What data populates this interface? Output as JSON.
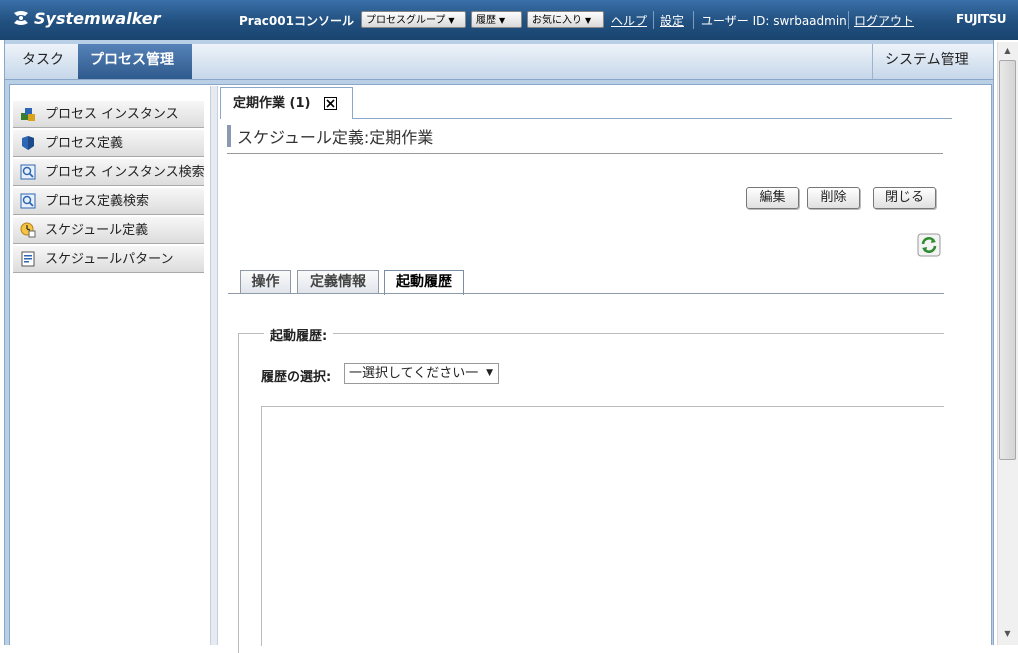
{
  "header": {
    "product": "Systemwalker",
    "console_title": "Prac001コンソール",
    "process_group_btn": "プロセスグループ",
    "history_btn": "履歴",
    "favorites_btn": "お気に入り",
    "help_link": "ヘルプ",
    "settings_link": "設定",
    "user_id": "ユーザー ID: swrbaadmin",
    "logout_link": "ログアウト",
    "vendor_logo": "FUJITSU"
  },
  "nav": {
    "task": "タスク",
    "process_mgmt": "プロセス管理",
    "system_mgmt": "システム管理"
  },
  "sidebar": {
    "items": [
      {
        "label": "プロセス インスタンス",
        "icon": "process-instance-icon"
      },
      {
        "label": "プロセス定義",
        "icon": "process-definition-icon"
      },
      {
        "label": "プロセス インスタンス検索",
        "icon": "search-icon"
      },
      {
        "label": "プロセス定義検索",
        "icon": "search-icon"
      },
      {
        "label": "スケジュール定義",
        "icon": "schedule-icon"
      },
      {
        "label": "スケジュールパターン",
        "icon": "schedule-pattern-icon"
      }
    ]
  },
  "document_tab": {
    "label": "定期作業 (1)",
    "close_icon": "close-icon"
  },
  "page": {
    "title": "スケジュール定義:定期作業",
    "buttons": {
      "edit": "編集",
      "delete": "削除",
      "close": "閉じる"
    },
    "refresh_icon": "refresh-icon",
    "subtabs": [
      "操作",
      "定義情報",
      "起動履歴"
    ],
    "active_subtab": "起動履歴",
    "history_section": {
      "legend": "起動履歴:",
      "select_label": "履歴の選択:",
      "select_value": "一選択してください一"
    }
  },
  "colors": {
    "header_bg": "#21507f",
    "active_tab_bg": "#2f5a8d",
    "frame_bg": "#b9cfe6"
  }
}
